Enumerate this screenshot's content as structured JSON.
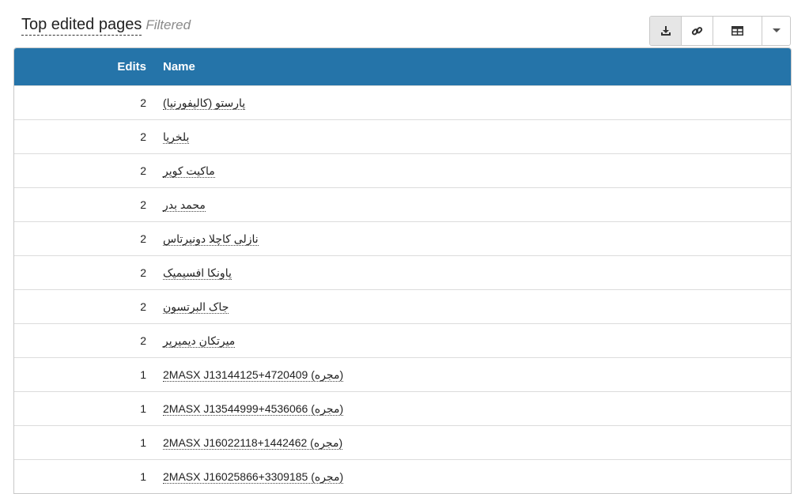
{
  "header": {
    "title": "Top edited pages",
    "filter_label": "Filtered"
  },
  "toolbar": {
    "buttons": [
      "download-icon",
      "link-icon",
      "table-icon",
      "caret-down-icon"
    ]
  },
  "table": {
    "columns": [
      "Edits",
      "Name"
    ],
    "rows": [
      {
        "edits": "2",
        "name": "پارستو (کالیفورنیا)"
      },
      {
        "edits": "2",
        "name": "بلخریا"
      },
      {
        "edits": "2",
        "name": "ماکیت کویر"
      },
      {
        "edits": "2",
        "name": "محمد بدر"
      },
      {
        "edits": "2",
        "name": "نازلی کاچلا دونیرتاس"
      },
      {
        "edits": "2",
        "name": "پاونکا افسیمیک"
      },
      {
        "edits": "2",
        "name": "جاک البرتسون"
      },
      {
        "edits": "2",
        "name": "میرتکان دیمیرپر"
      },
      {
        "edits": "1",
        "name": "2MASX J13144125+4720409 (مجره)"
      },
      {
        "edits": "1",
        "name": "2MASX J13544999+4536066 (مجره)"
      },
      {
        "edits": "1",
        "name": "2MASX J16022118+1442462 (مجره)"
      },
      {
        "edits": "1",
        "name": "2MASX J16025866+3309185 (مجره)"
      }
    ]
  },
  "colors": {
    "header_bg": "#2574a9",
    "header_text": "#ffffff",
    "active_button_bg": "#e6e6e6"
  }
}
